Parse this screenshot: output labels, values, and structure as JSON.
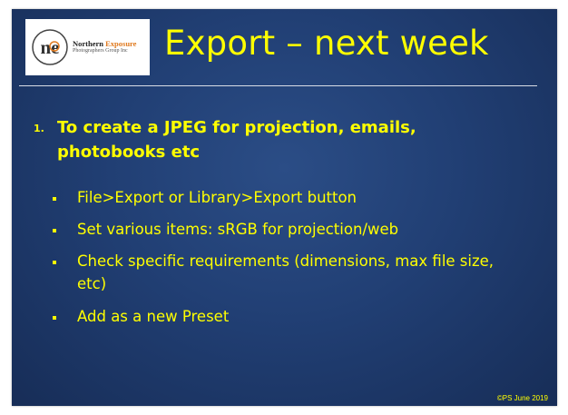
{
  "slide": {
    "title": "Export – next week",
    "logo": {
      "mark_text": "ne",
      "name_part1": "Northern ",
      "name_part2": "Exposure",
      "subtitle": "Photographers Group Inc"
    },
    "numbered_item": {
      "marker": "1.",
      "text": "To create a JPEG for projection, emails, photobooks etc"
    },
    "bullets": [
      "File>Export or Library>Export button",
      "Set various items: sRGB for projection/web",
      "Check specific requirements (dimensions, max file size, etc)",
      "Add as a new Preset"
    ],
    "footer": "©PS June 2019"
  },
  "colors": {
    "background": "#213f74",
    "text": "#ffff00",
    "rule": "#d9dde6",
    "logo_accent": "#e07a1f"
  }
}
